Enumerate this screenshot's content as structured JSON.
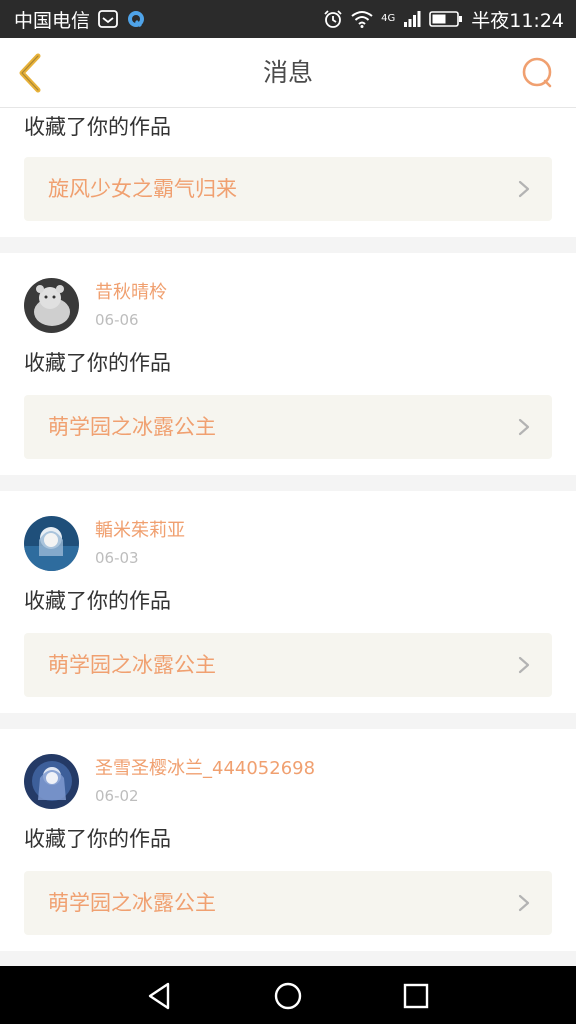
{
  "status_bar": {
    "carrier": "中国电信",
    "network": "4G",
    "time": "半夜11:24",
    "icons": [
      "message-icon",
      "app-icon",
      "alarm-icon",
      "wifi-icon",
      "signal-icon",
      "battery-icon"
    ]
  },
  "header": {
    "title": "消息",
    "back_icon": "chevron-left-icon",
    "search_icon": "search-icon"
  },
  "colors": {
    "accent": "#f0a070",
    "work_box_bg": "#f6f5ef",
    "page_bg": "#f4f4f4",
    "status_bar_bg": "#2b2b2b"
  },
  "messages": [
    {
      "action": "收藏了你的作品",
      "work": "旋风少女之霸气归来"
    },
    {
      "username": "昔秋晴柃",
      "date": "06-06",
      "action": "收藏了你的作品",
      "work": "萌学园之冰露公主"
    },
    {
      "username": "輴米茱莉亚",
      "date": "06-03",
      "action": "收藏了你的作品",
      "work": "萌学园之冰露公主"
    },
    {
      "username": "圣雪圣樱冰兰_444052698",
      "date": "06-02",
      "action": "收藏了你的作品",
      "work": "萌学园之冰露公主"
    }
  ],
  "nav_bar": {
    "icons": [
      "back-triangle-icon",
      "home-circle-icon",
      "recents-square-icon"
    ]
  }
}
